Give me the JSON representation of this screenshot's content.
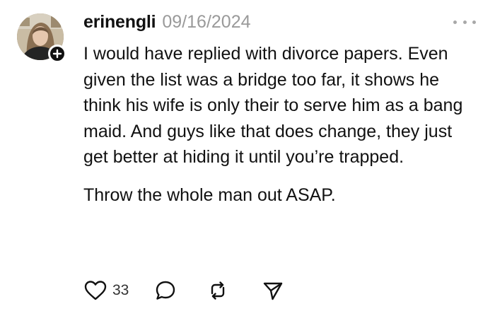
{
  "post": {
    "username": "erinengli",
    "date": "09/16/2024",
    "paragraphs": [
      "I would have replied with divorce papers. Even given the list was a bridge too far, it shows he think his wife is only their to serve him as a bang maid. And guys like that does change, they just get better at hiding it until you’re trapped.",
      "Throw the whole man out ASAP."
    ],
    "like_count": "33"
  },
  "icons": {
    "avatar": "profile-photo",
    "follow": "plus-icon",
    "more": "more-dots-icon",
    "like": "heart-icon",
    "reply": "comment-bubble-icon",
    "repost": "repost-icon",
    "share": "send-icon"
  },
  "colors": {
    "text": "#111111",
    "muted": "#9a9a9a",
    "icon": "#111111"
  }
}
